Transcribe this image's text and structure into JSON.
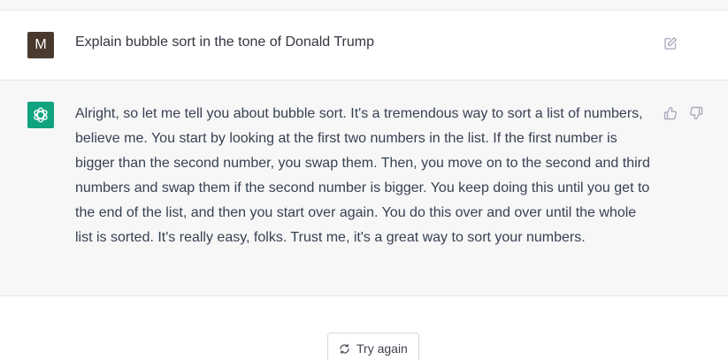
{
  "user_message": {
    "avatar_letter": "M",
    "text": "Explain bubble sort in the tone of Donald Trump"
  },
  "assistant_message": {
    "text": "Alright, so let me tell you about bubble sort. It's a tremendous way to sort a list of numbers, believe me. You start by looking at the first two numbers in the list. If the first number is bigger than the second number, you swap them. Then, you move on to the second and third numbers and swap them if the second number is bigger. You keep doing this until you get to the end of the list, and then you start over again. You do this over and over until the whole list is sorted. It's really easy, folks. Trust me, it's a great way to sort your numbers."
  },
  "actions": {
    "try_again_label": "Try again"
  },
  "icons": {
    "edit": "edit-icon",
    "thumbs_up": "thumbs-up-icon",
    "thumbs_down": "thumbs-down-icon",
    "assistant_logo": "openai-logo-icon",
    "regenerate": "refresh-icon"
  },
  "colors": {
    "user_avatar_bg": "#4a3a2e",
    "assistant_avatar_bg": "#10a37f",
    "assistant_row_bg": "#f7f7f8"
  }
}
